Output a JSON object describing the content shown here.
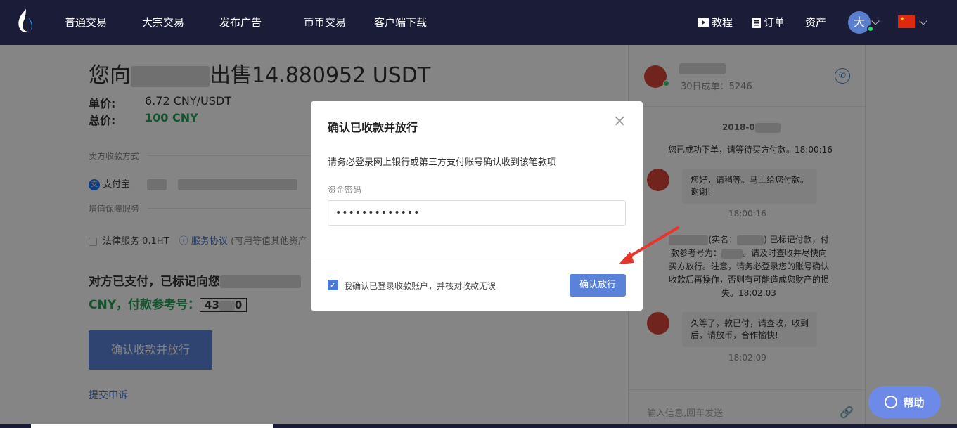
{
  "nav": {
    "items": [
      "普通交易",
      "大宗交易",
      "发布广告",
      "币币交易",
      "客户端下载"
    ],
    "tutorial": "教程",
    "orders": "订单",
    "assets": "资产",
    "avatar_text": "大"
  },
  "order": {
    "title_prefix": "您向",
    "title_suffix": "出售14.880952 USDT",
    "price_label": "单价:",
    "price_value": "6.72 CNY/USDT",
    "total_label": "总价:",
    "total_value": "100 CNY",
    "seller_method_label": "卖方收款方式",
    "alipay_label": "支付宝",
    "value_added_label": "增值保障服务",
    "legal_service": "法律服务 0.1HT",
    "service_agreement": "服务协议",
    "service_note": "(可用等值其他资产",
    "paid_line_prefix": "对方已支付，已标记向您",
    "paid_line2_prefix": "CNY，付款参考号：",
    "ref_partial_a": "43",
    "ref_partial_b": "0",
    "confirm_button": "确认收款并放行",
    "appeal_link": "提交申诉"
  },
  "chat": {
    "orders_30d": "30日成单：5246",
    "date_prefix": "2018-0",
    "system_msg": "您已成功下单，请等待买方付款。18:00:16",
    "msg1": "您好，请稍等。马上给您付款。谢谢!",
    "msg1_time": "18:00:16",
    "sys2_line1": "(实名：",
    "sys2_line1b": ") 已标记付款，付",
    "sys2_line2": "款参考号为：",
    "sys2_line2b": "。请及时查收并尽快向",
    "sys2_line3": "买方放行。注意，请务必登录您的账号确认",
    "sys2_line4": "收款后再操作，否则有可能造成您财产的损",
    "sys2_line5": "失。18:02:03",
    "msg2": "久等了，款已付，请查收，收到后，请放币，合作愉快!",
    "msg2_time": "18:02:09",
    "input_placeholder": "输入信息,回车发送"
  },
  "help_button": "帮助",
  "modal": {
    "title": "确认已收款并放行",
    "notice": "请务必登录网上银行或第三方支付账号确认收到该笔款项",
    "password_label": "资金密码",
    "password_value": "•••••••••••••",
    "checkbox_label": "我确认已登录收款账户，并核对收款无误",
    "confirm_button": "确认放行"
  },
  "colors": {
    "nav_bg": "#1b1d38",
    "accent": "#5b82d9",
    "green": "#2a9d58",
    "arrow": "#e8352b"
  }
}
